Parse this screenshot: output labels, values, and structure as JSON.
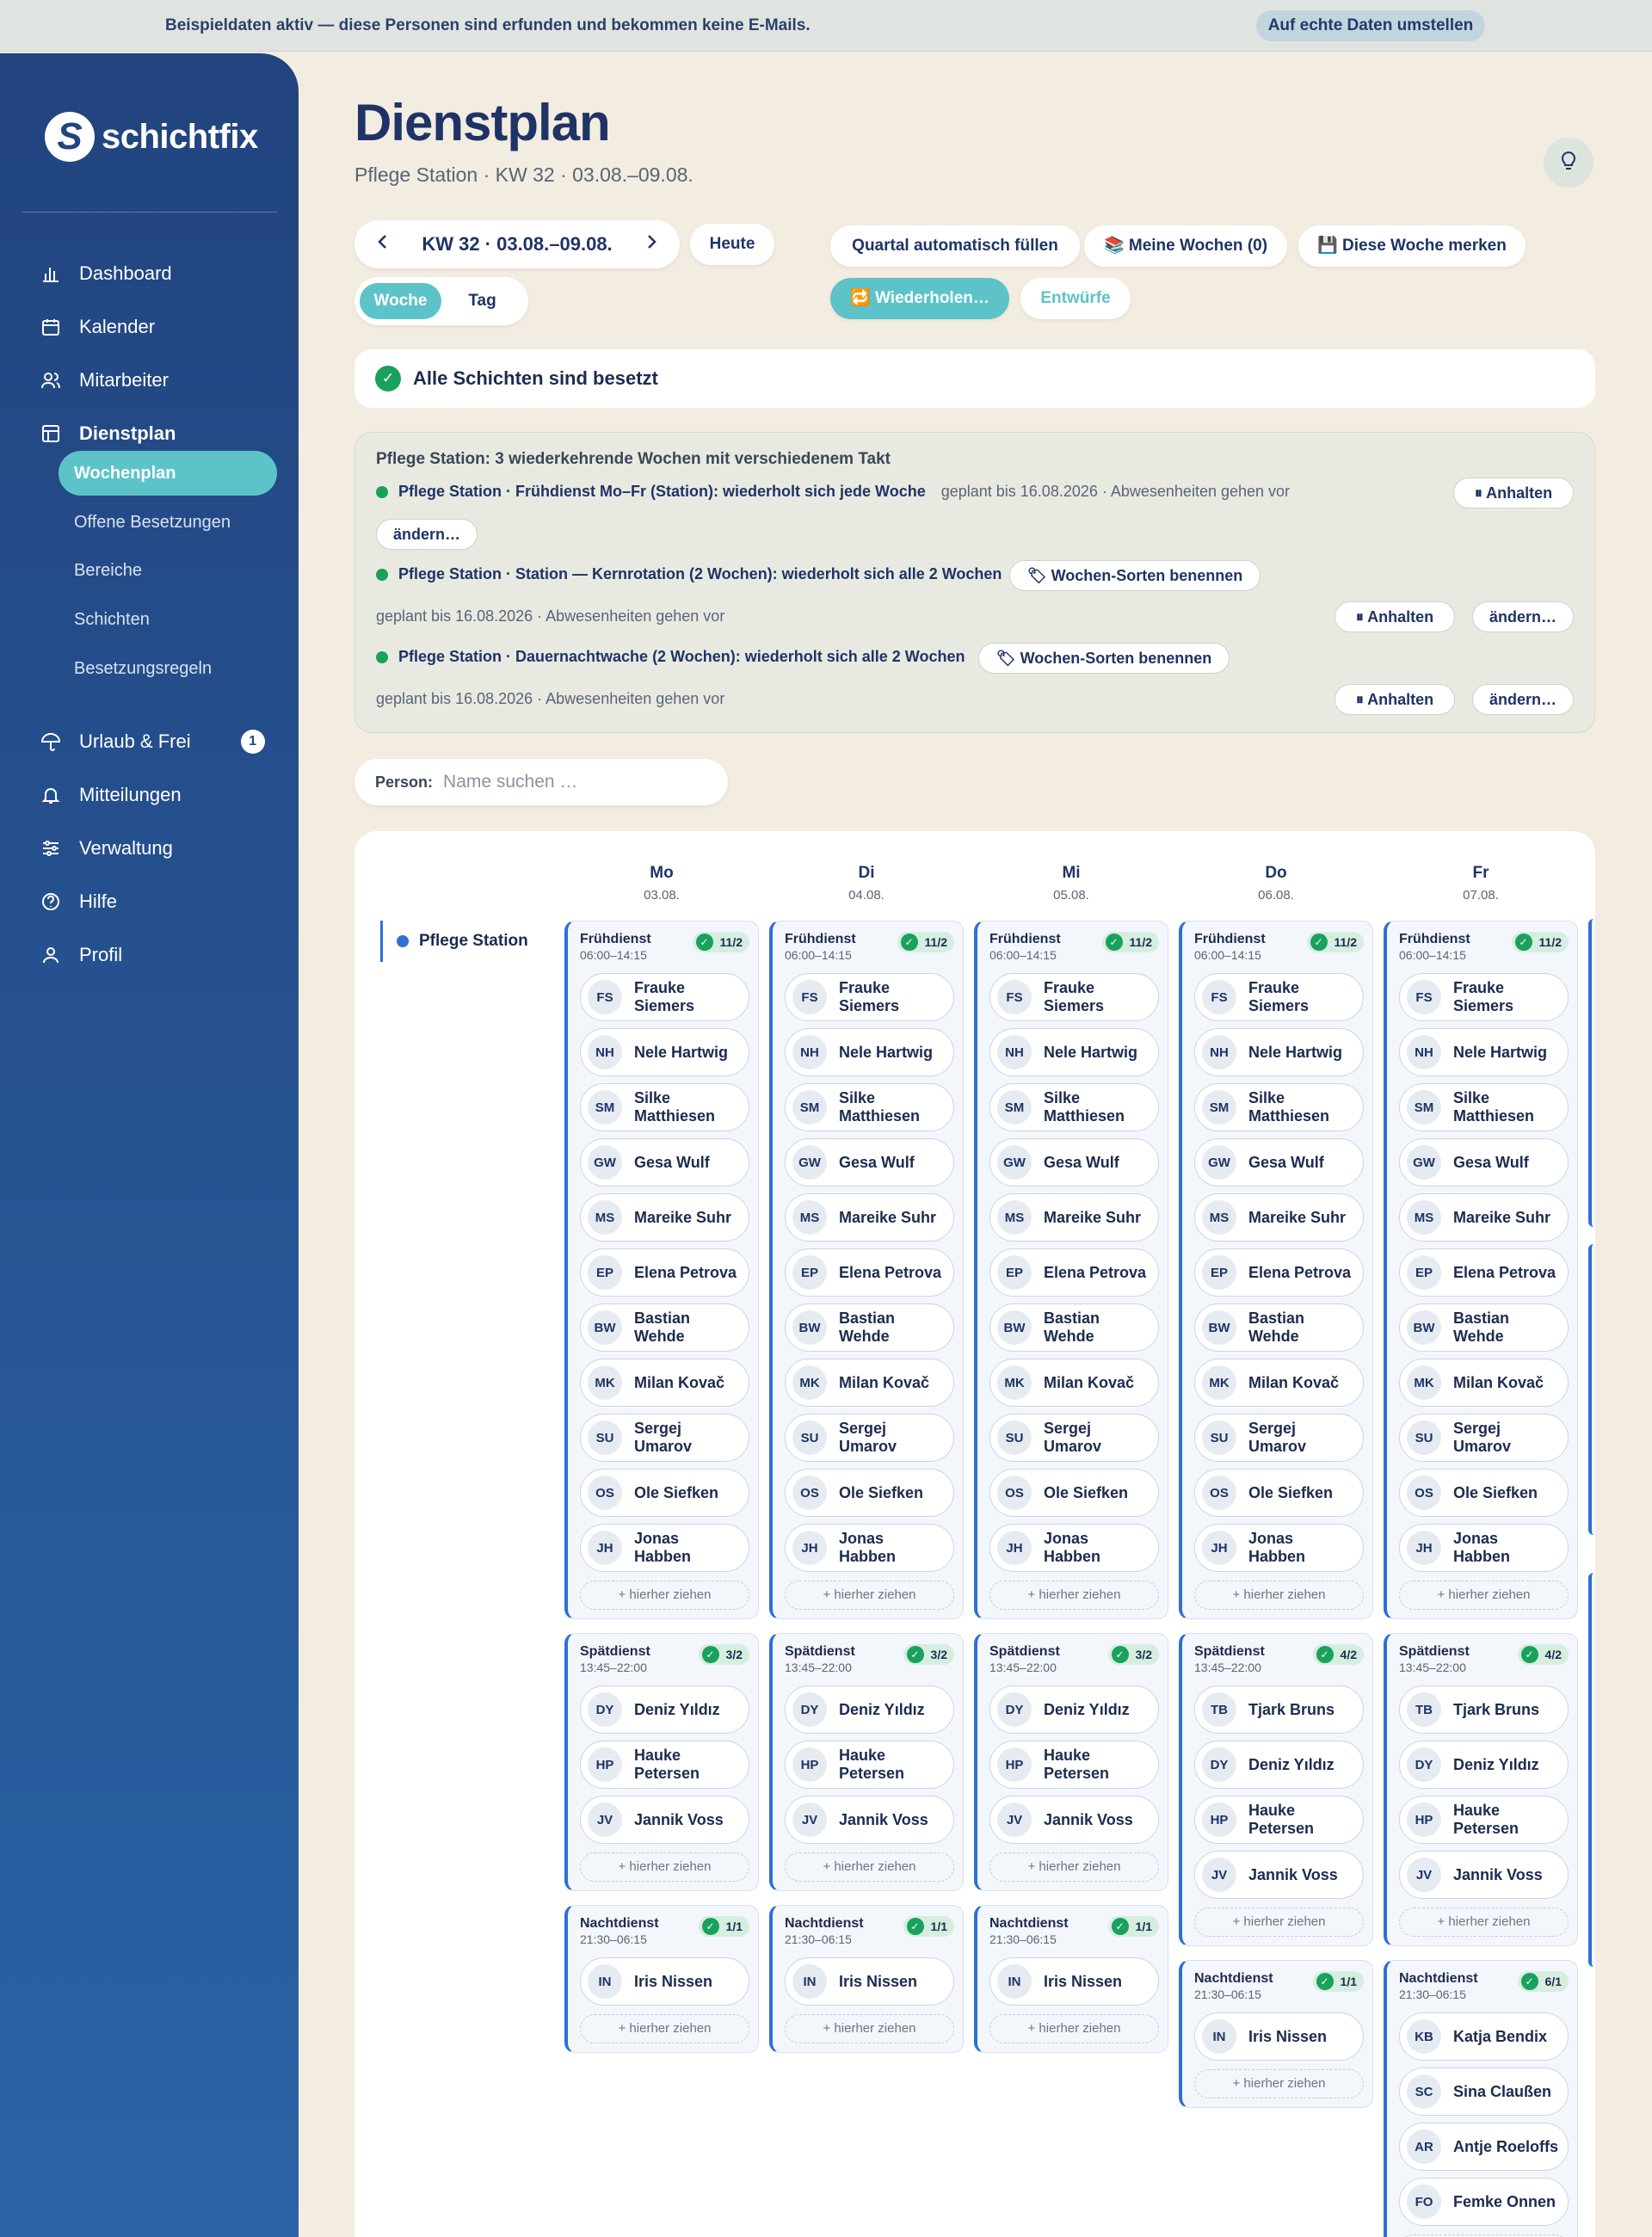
{
  "banner": {
    "text": "Beispieldaten aktiv — diese Personen sind erfunden und bekommen keine E-Mails.",
    "button": "Auf echte Daten umstellen"
  },
  "sidebar": {
    "brand": "schichtfix",
    "logo_letter": "S",
    "items": [
      {
        "label": "Dashboard",
        "icon": "bar-chart-icon"
      },
      {
        "label": "Kalender",
        "icon": "calendar-icon"
      },
      {
        "label": "Mitarbeiter",
        "icon": "users-icon"
      },
      {
        "label": "Dienstplan",
        "icon": "grid-icon",
        "active": true
      },
      {
        "label": "Urlaub & Frei",
        "icon": "umbrella-icon",
        "badge": "1"
      },
      {
        "label": "Mitteilungen",
        "icon": "bell-icon"
      },
      {
        "label": "Verwaltung",
        "icon": "sliders-icon"
      },
      {
        "label": "Hilfe",
        "icon": "help-icon"
      },
      {
        "label": "Profil",
        "icon": "user-icon"
      }
    ],
    "subitems": [
      "Wochenplan",
      "Offene Besetzungen",
      "Bereiche",
      "Schichten",
      "Besetzungsregeln"
    ]
  },
  "header": {
    "title": "Dienstplan",
    "subtitle": "Pflege Station · KW 32 · 03.08.–09.08."
  },
  "toolbar": {
    "week_label": "KW 32 · 03.08.–09.08.",
    "today": "Heute",
    "view_week": "Woche",
    "view_day": "Tag",
    "fill_quarter": "Quartal automatisch füllen",
    "my_weeks": "📚 Meine Wochen (0)",
    "save_week": "💾 Diese Woche merken",
    "repeat": "🔁 Wiederholen…",
    "drafts": "Entwürfe"
  },
  "status": {
    "text": "Alle Schichten sind besetzt"
  },
  "recurring": {
    "heading": "Pflege Station: 3 wiederkehrende Wochen mit verschiedenem Takt",
    "items": [
      {
        "title": "Pflege Station · Frühdienst Mo–Fr (Station): wiederholt sich jede Woche",
        "meta": "geplant bis 16.08.2026 · Abwesenheiten gehen vor",
        "pause": "⏸ Anhalten",
        "edit": "ändern…"
      },
      {
        "title": "Pflege Station · Station — Kernrotation (2 Wochen): wiederholt sich alle 2 Wochen",
        "name_btn": "🏷 Wochen-Sorten benennen",
        "meta": "geplant bis 16.08.2026 · Abwesenheiten gehen vor",
        "pause": "⏸ Anhalten",
        "edit": "ändern…"
      },
      {
        "title": "Pflege Station · Dauernachtwache (2 Wochen): wiederholt sich alle 2 Wochen",
        "name_btn": "🏷 Wochen-Sorten benennen",
        "meta": "geplant bis 16.08.2026 · Abwesenheiten gehen vor",
        "pause": "⏸ Anhalten",
        "edit": "ändern…"
      }
    ]
  },
  "search": {
    "label": "Person:",
    "placeholder": "Name suchen …",
    "value": ""
  },
  "board": {
    "area": "Pflege Station",
    "drop_label": "+ hierher ziehen",
    "days": [
      {
        "name": "Mo",
        "date": "03.08."
      },
      {
        "name": "Di",
        "date": "04.08."
      },
      {
        "name": "Mi",
        "date": "05.08."
      },
      {
        "name": "Do",
        "date": "06.08."
      },
      {
        "name": "Fr",
        "date": "07.08."
      }
    ],
    "columns": [
      {
        "shifts": [
          {
            "name": "Frühdienst",
            "time": "06:00–14:15",
            "count": "11/2",
            "people": [
              "FS|Frauke Siemers",
              "NH|Nele Hartwig",
              "SM|Silke Matthiesen",
              "GW|Gesa Wulf",
              "MS|Mareike Suhr",
              "EP|Elena Petrova",
              "BW|Bastian Wehde",
              "MK|Milan Kovač",
              "SU|Sergej Umarov",
              "OS|Ole Siefken",
              "JH|Jonas Habben"
            ]
          },
          {
            "name": "Spätdienst",
            "time": "13:45–22:00",
            "count": "3/2",
            "people": [
              "DY|Deniz Yıldız",
              "HP|Hauke Petersen",
              "JV|Jannik Voss"
            ]
          },
          {
            "name": "Nachtdienst",
            "time": "21:30–06:15",
            "count": "1/1",
            "people": [
              "IN|Iris Nissen"
            ]
          }
        ]
      },
      {
        "shifts": [
          {
            "name": "Frühdienst",
            "time": "06:00–14:15",
            "count": "11/2",
            "people": [
              "FS|Frauke Siemers",
              "NH|Nele Hartwig",
              "SM|Silke Matthiesen",
              "GW|Gesa Wulf",
              "MS|Mareike Suhr",
              "EP|Elena Petrova",
              "BW|Bastian Wehde",
              "MK|Milan Kovač",
              "SU|Sergej Umarov",
              "OS|Ole Siefken",
              "JH|Jonas Habben"
            ]
          },
          {
            "name": "Spätdienst",
            "time": "13:45–22:00",
            "count": "3/2",
            "people": [
              "DY|Deniz Yıldız",
              "HP|Hauke Petersen",
              "JV|Jannik Voss"
            ]
          },
          {
            "name": "Nachtdienst",
            "time": "21:30–06:15",
            "count": "1/1",
            "people": [
              "IN|Iris Nissen"
            ]
          }
        ]
      },
      {
        "shifts": [
          {
            "name": "Frühdienst",
            "time": "06:00–14:15",
            "count": "11/2",
            "people": [
              "FS|Frauke Siemers",
              "NH|Nele Hartwig",
              "SM|Silke Matthiesen",
              "GW|Gesa Wulf",
              "MS|Mareike Suhr",
              "EP|Elena Petrova",
              "BW|Bastian Wehde",
              "MK|Milan Kovač",
              "SU|Sergej Umarov",
              "OS|Ole Siefken",
              "JH|Jonas Habben"
            ]
          },
          {
            "name": "Spätdienst",
            "time": "13:45–22:00",
            "count": "3/2",
            "people": [
              "DY|Deniz Yıldız",
              "HP|Hauke Petersen",
              "JV|Jannik Voss"
            ]
          },
          {
            "name": "Nachtdienst",
            "time": "21:30–06:15",
            "count": "1/1",
            "people": [
              "IN|Iris Nissen"
            ]
          }
        ]
      },
      {
        "shifts": [
          {
            "name": "Frühdienst",
            "time": "06:00–14:15",
            "count": "11/2",
            "people": [
              "FS|Frauke Siemers",
              "NH|Nele Hartwig",
              "SM|Silke Matthiesen",
              "GW|Gesa Wulf",
              "MS|Mareike Suhr",
              "EP|Elena Petrova",
              "BW|Bastian Wehde",
              "MK|Milan Kovač",
              "SU|Sergej Umarov",
              "OS|Ole Siefken",
              "JH|Jonas Habben"
            ]
          },
          {
            "name": "Spätdienst",
            "time": "13:45–22:00",
            "count": "4/2",
            "people": [
              "TB|Tjark Bruns",
              "DY|Deniz Yıldız",
              "HP|Hauke Petersen",
              "JV|Jannik Voss"
            ]
          },
          {
            "name": "Nachtdienst",
            "time": "21:30–06:15",
            "count": "1/1",
            "people": [
              "IN|Iris Nissen"
            ]
          }
        ]
      },
      {
        "shifts": [
          {
            "name": "Frühdienst",
            "time": "06:00–14:15",
            "count": "11/2",
            "people": [
              "FS|Frauke Siemers",
              "NH|Nele Hartwig",
              "SM|Silke Matthiesen",
              "GW|Gesa Wulf",
              "MS|Mareike Suhr",
              "EP|Elena Petrova",
              "BW|Bastian Wehde",
              "MK|Milan Kovač",
              "SU|Sergej Umarov",
              "OS|Ole Siefken",
              "JH|Jonas Habben"
            ]
          },
          {
            "name": "Spätdienst",
            "time": "13:45–22:00",
            "count": "4/2",
            "people": [
              "TB|Tjark Bruns",
              "DY|Deniz Yıldız",
              "HP|Hauke Petersen",
              "JV|Jannik Voss"
            ]
          },
          {
            "name": "Nachtdienst",
            "time": "21:30–06:15",
            "count": "6/1",
            "people": [
              "KB|Katja Bendix",
              "SC|Sina Claußen",
              "AR|Antje Roeloffs",
              "FO|Femke Onnen"
            ]
          }
        ]
      }
    ]
  }
}
